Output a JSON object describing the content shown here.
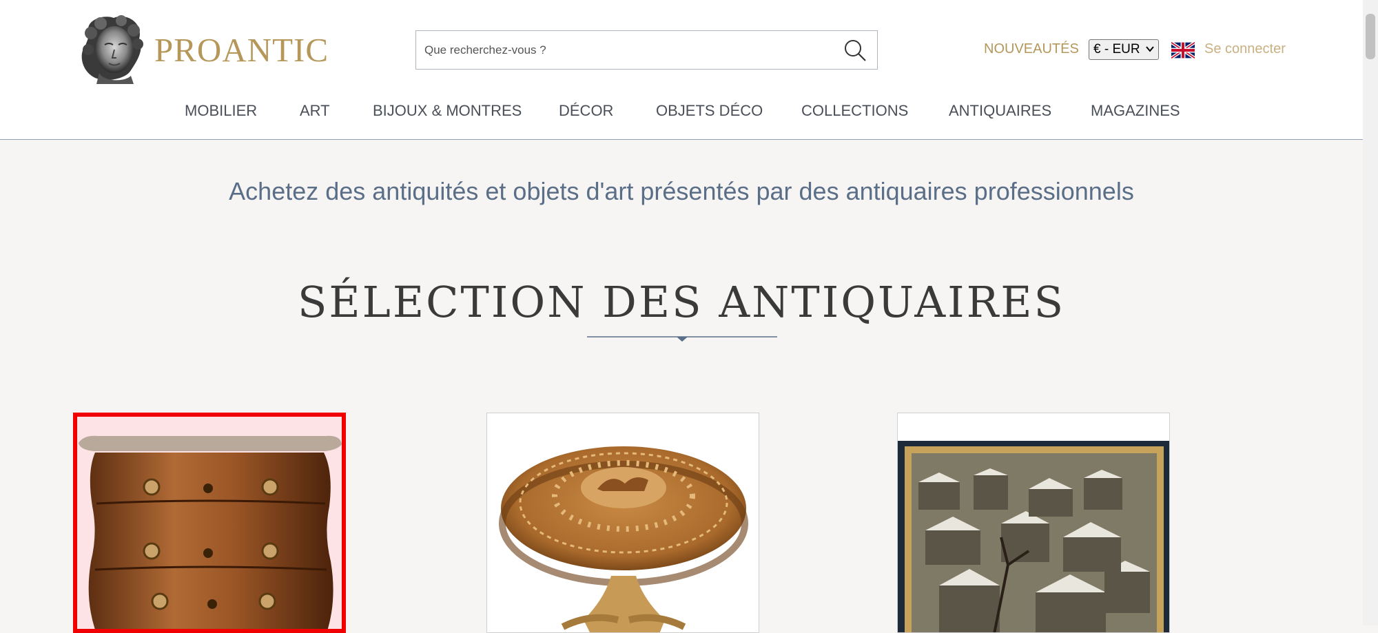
{
  "header": {
    "logo_text": "PROANTIC",
    "search": {
      "placeholder": "Que recherchez-vous ?"
    },
    "new_label": "NOUVEAUTÉS",
    "currency_selected": "€ - EUR",
    "login_label": "Se connecter",
    "brand_color": "#b5975a"
  },
  "nav": {
    "items": [
      "MOBILIER",
      "ART",
      "BIJOUX & MONTRES",
      "DÉCOR",
      "OBJETS DÉCO",
      "COLLECTIONS",
      "ANTIQUAIRES",
      "MAGAZINES"
    ]
  },
  "main": {
    "tagline": "Achetez des antiquités et objets d'art présentés par des antiquaires professionnels",
    "section_title": "SÉLECTION DES ANTIQUAIRES",
    "cards": [
      {
        "subject": "commode",
        "selected": true
      },
      {
        "subject": "marquetry table",
        "selected": false
      },
      {
        "subject": "winter rooftops painting",
        "selected": false
      }
    ]
  }
}
